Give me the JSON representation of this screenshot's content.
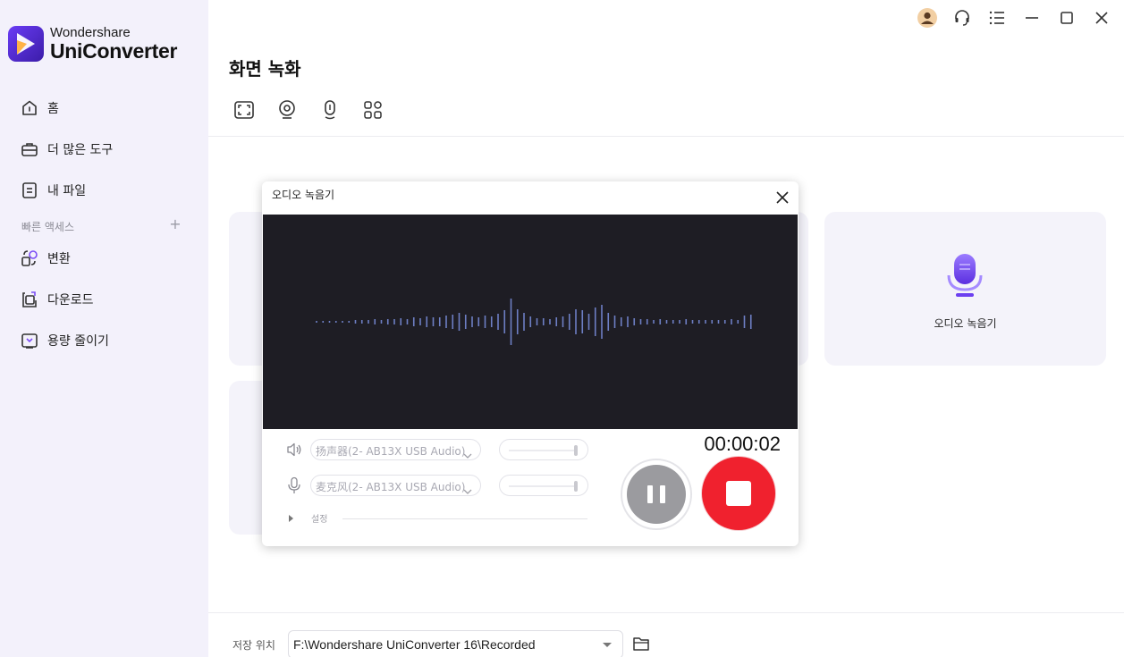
{
  "app": {
    "brand": "Wondershare",
    "product": "UniConverter",
    "accent_color": "#6a3cf5"
  },
  "sidebar": {
    "items": [
      {
        "label": "홈",
        "icon": "home-icon"
      },
      {
        "label": "더 많은 도구",
        "icon": "toolbox-icon"
      },
      {
        "label": "내 파일",
        "icon": "file-icon"
      }
    ],
    "quick_access_label": "빠른 액세스",
    "quick_items": [
      {
        "label": "변환",
        "icon": "convert-icon"
      },
      {
        "label": "다운로드",
        "icon": "download-icon"
      },
      {
        "label": "용량 줄이기",
        "icon": "compress-icon"
      }
    ]
  },
  "header": {
    "page_title": "화면 녹화",
    "tabs": [
      "screen-record-icon",
      "webcam-icon",
      "audio-record-icon",
      "apps-icon"
    ]
  },
  "cards": {
    "audio_recorder_label": "오디오 녹음기"
  },
  "dialog": {
    "title": "오디오 녹음기",
    "timer": "00:00:02",
    "speaker_device": "扬声器(2- AB13X USB Audio)",
    "mic_device": "麦克风(2- AB13X USB Audio)",
    "settings_label": "설정",
    "stop_color": "#f0212e",
    "wave_color": "#6d7fc4",
    "wave_background": "#1e1d24"
  },
  "footer": {
    "save_location_label": "저장 위치",
    "save_path": "F:\\Wondershare UniConverter 16\\Recorded"
  }
}
